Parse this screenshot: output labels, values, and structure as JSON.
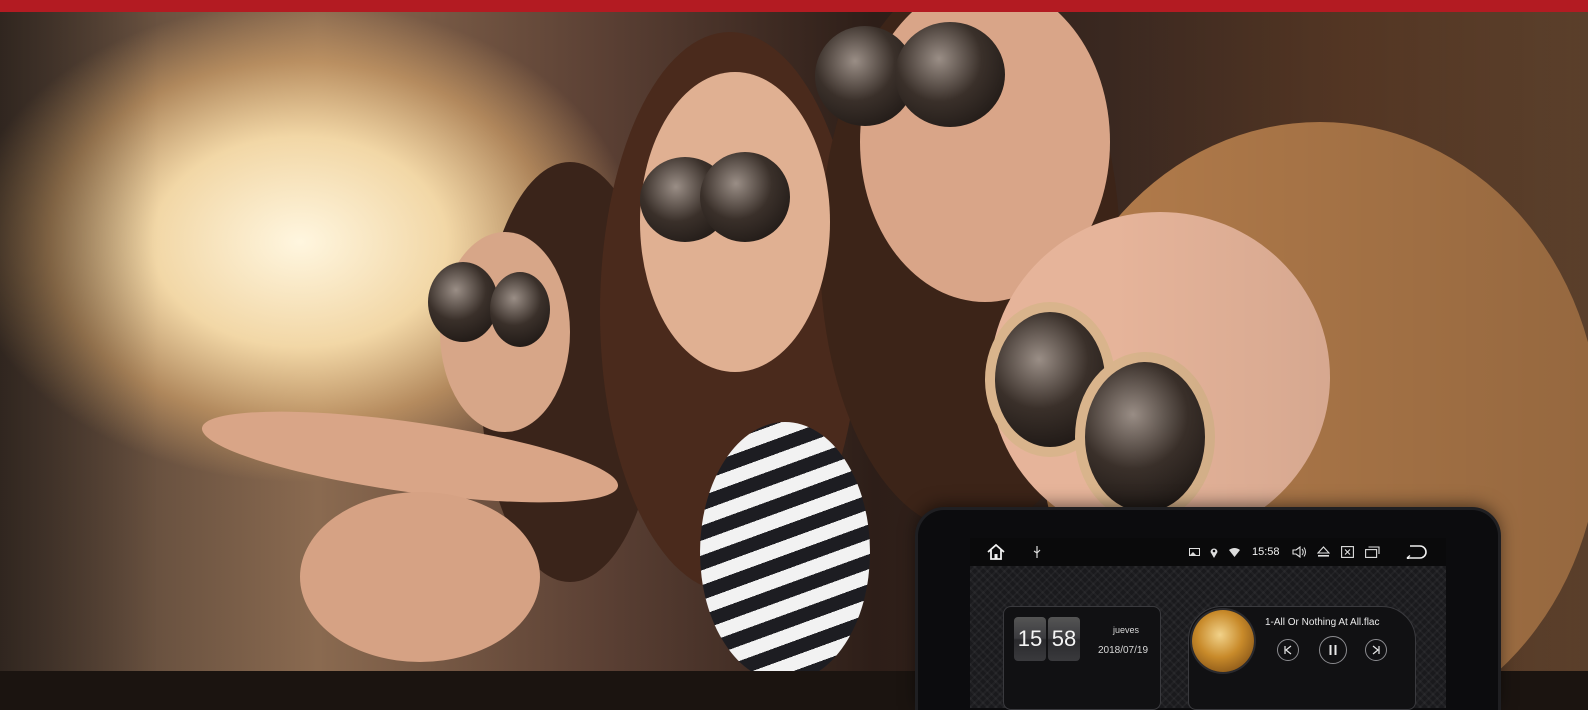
{
  "device": {
    "status_bar": {
      "time": "15:58",
      "icons": [
        "home-icon",
        "usb-icon",
        "cast-icon",
        "location-icon",
        "wifi-icon",
        "volume-icon",
        "eject-icon",
        "close-box-icon",
        "recent-apps-icon",
        "back-icon"
      ]
    },
    "clock_widget": {
      "hour": "15",
      "minute": "58",
      "weekday": "jueves",
      "date": "2018/07/19"
    },
    "music_widget": {
      "track": "1-All Or Nothing At All.flac",
      "controls": [
        "previous",
        "pause",
        "next"
      ]
    }
  },
  "colors": {
    "top_bar": "#b31b22",
    "device_bezel": "#0c0c0e",
    "screen_bg": "#1a1a1d"
  }
}
